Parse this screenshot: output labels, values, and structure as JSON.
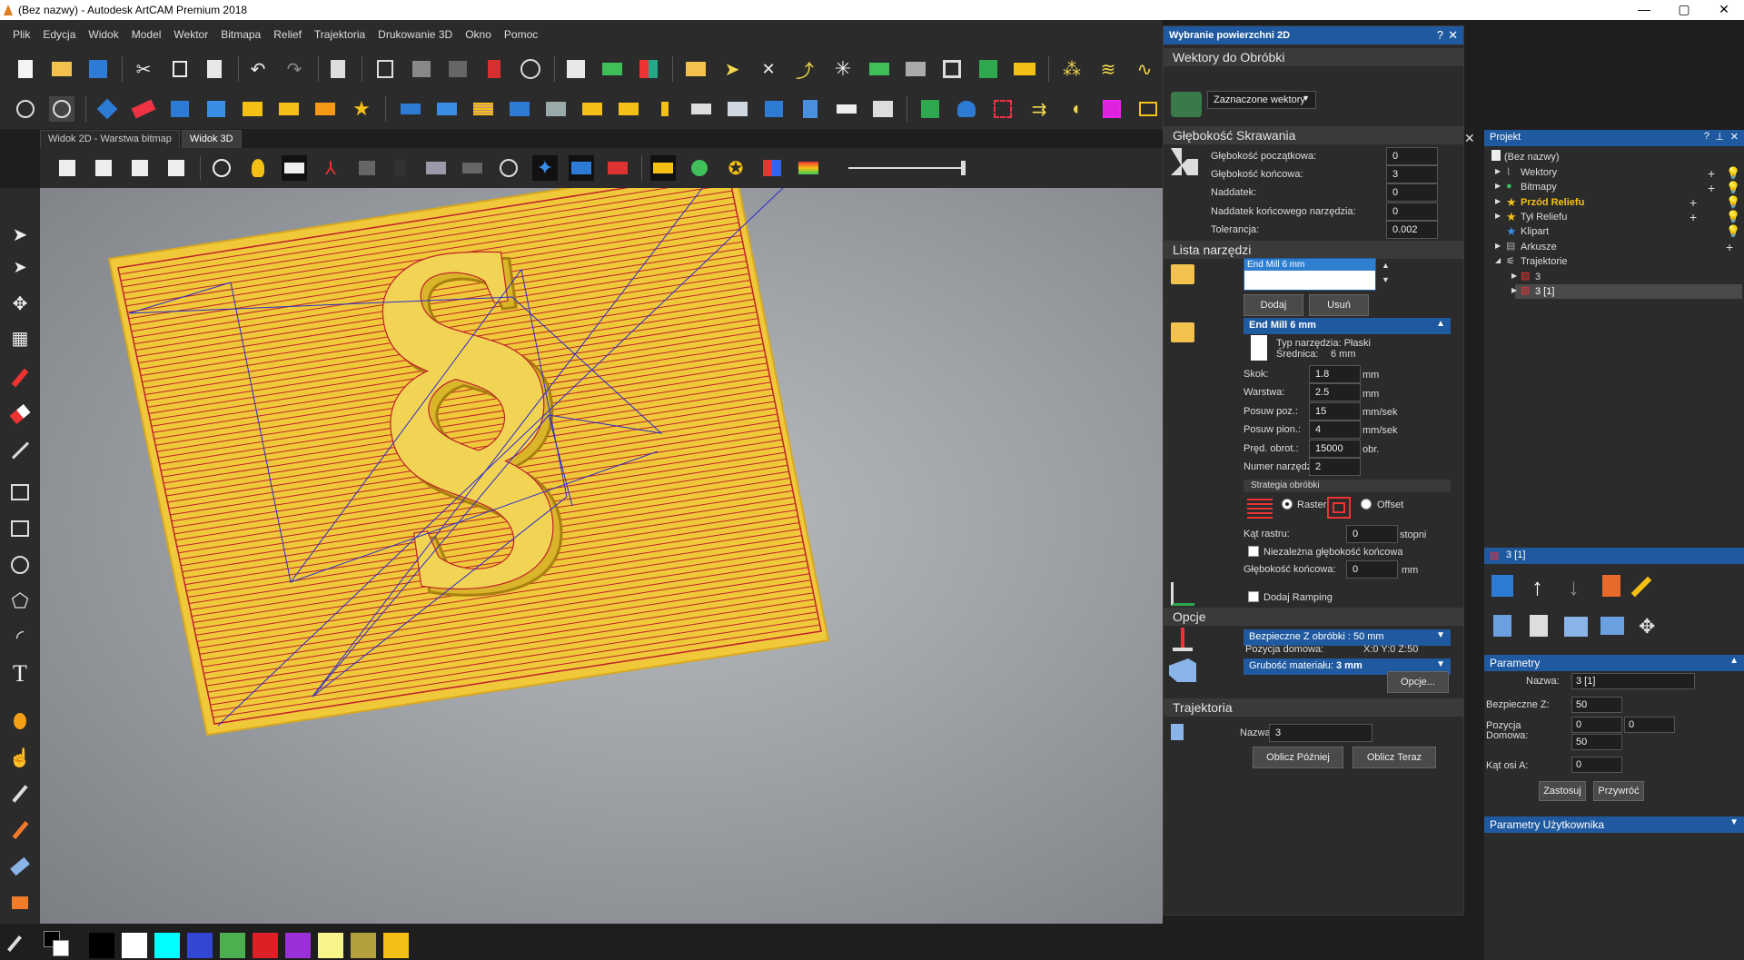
{
  "window": {
    "title": "(Bez nazwy) - Autodesk ArtCAM Premium 2018",
    "minimize": "—",
    "maximize": "▢",
    "close": "✕"
  },
  "menu": [
    "Plik",
    "Edycja",
    "Widok",
    "Model",
    "Wektor",
    "Bitmapa",
    "Relief",
    "Trajektoria",
    "Drukowanie 3D",
    "Okno",
    "Pomoc"
  ],
  "view_tabs": [
    "Widok 2D - Warstwa bitmap",
    "Widok 3D"
  ],
  "panel": {
    "title": "Wybranie powierzchni 2D",
    "help": "?",
    "close": "✕",
    "vectors_section": "Wektory do Obróbki",
    "vectors_select": "Zaznaczone wektory",
    "depth_section": "Głębokość Skrawania",
    "depth_fields": [
      {
        "label": "Głębokość początkowa:",
        "value": "0"
      },
      {
        "label": "Głębokość końcowa:",
        "value": "3"
      },
      {
        "label": "Naddatek:",
        "value": "0"
      },
      {
        "label": "Naddatek końcowego narzędzia:",
        "value": "0"
      },
      {
        "label": "Tolerancja:",
        "value": "0.002"
      }
    ],
    "tools_section": "Lista narzędzi",
    "tool_selected": "End Mill 6 mm",
    "add_btn": "Dodaj",
    "remove_btn": "Usuń",
    "tool_header": "End Mill 6 mm",
    "tool_type": "Typ narzędzia: Płaski",
    "tool_diameter_label": "Średnica:",
    "tool_diameter_value": "6 mm",
    "tool_params": [
      {
        "label": "Skok:",
        "value": "1.8",
        "unit": "mm"
      },
      {
        "label": "Warstwa:",
        "value": "2.5",
        "unit": "mm"
      },
      {
        "label": "Posuw poz.:",
        "value": "15",
        "unit": "mm/sek"
      },
      {
        "label": "Posuw pion.:",
        "value": "4",
        "unit": "mm/sek"
      },
      {
        "label": "Pręd. obrot.:",
        "value": "15000",
        "unit": "obr."
      },
      {
        "label": "Numer narzędzia:",
        "value": "2",
        "unit": ""
      }
    ],
    "strategy_header": "Strategia obróbki",
    "raster_label": "Raster",
    "offset_label": "Offset",
    "raster_angle_label": "Kąt rastru:",
    "raster_angle_value": "0",
    "raster_angle_unit": "stopni",
    "independent_depth_label": "Niezależna głębokość końcowa",
    "final_depth_label": "Głębokość końcowa:",
    "final_depth_value": "0",
    "final_depth_unit": "mm",
    "ramping_label": "Dodaj Ramping",
    "options_section": "Opcje",
    "safe_z_bar": "Bezpieczne Z obróbki : 50 mm",
    "home_label": "Pozycja domowa:",
    "home_value": "X:0 Y:0 Z:50",
    "material_bar_prefix": "Grubość materiału:",
    "material_bar_value": "3 mm",
    "options_btn": "Opcje...",
    "toolpath_section": "Trajektoria",
    "name_label": "Nazwa:",
    "name_value": "3",
    "calc_later": "Oblicz Później",
    "calc_now": "Oblicz Teraz"
  },
  "project": {
    "title": "Projekt",
    "help": "?",
    "pin": "⊥",
    "close": "✕",
    "root": "(Bez nazwy)",
    "items": [
      "Wektory",
      "Bitmapy",
      "Przód Reliefu",
      "Tył Reliefu",
      "Klipart",
      "Arkusze",
      "Trajektorie"
    ],
    "toolpaths": [
      "3",
      "3 [1]"
    ]
  },
  "selection": {
    "title": "3 [1]",
    "params_header": "Parametry",
    "name_label": "Nazwa:",
    "name_value": "3 [1]",
    "safe_z_label": "Bezpieczne Z:",
    "safe_z_value": "50",
    "home_label_1": "Pozycja",
    "home_label_2": "Domowa:",
    "home_x": "0",
    "home_y": "0",
    "home_z": "50",
    "axis_a_label": "Kąt osi A:",
    "axis_a_value": "0",
    "apply_btn": "Zastosuj",
    "restore_btn": "Przywróć",
    "user_params_header": "Parametry Użytkownika"
  },
  "colors": {
    "accent": "#1f5aa0",
    "sheet": "#f0c93a",
    "raster": "#c0202a",
    "vector": "#2a2acc"
  },
  "palette": [
    "#000000",
    "#ffffff",
    "#00ffff",
    "#3346d6",
    "#4caf50",
    "#dd1f26",
    "#9b30d9",
    "#f7f48a",
    "#b3a03d",
    "#f5c016"
  ]
}
